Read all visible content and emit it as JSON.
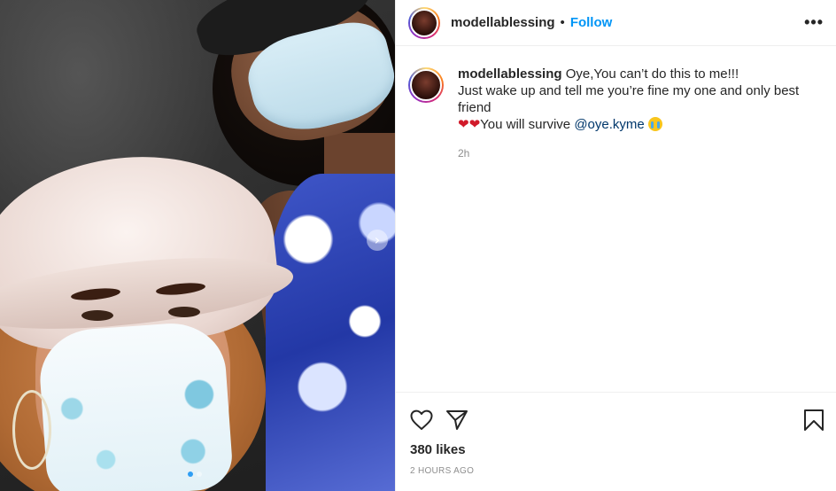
{
  "post": {
    "carousel_count": 2,
    "carousel_index": 1
  },
  "header": {
    "username": "modellablessing",
    "separator": "•",
    "follow_label": "Follow",
    "more_label": "•••"
  },
  "caption": {
    "username": "modellablessing",
    "line1": "Oye,You can’t do this to me!!!",
    "line2": "Just wake up and tell me you’re fine my one and only best friend",
    "hearts": "❤❤",
    "line3": "You will survive ",
    "mention": "@oye.kyme",
    "emoji": "crying-face",
    "time_ago": "2h"
  },
  "actions": {
    "like_icon": "heart-outline-icon",
    "share_icon": "paper-plane-icon",
    "save_icon": "bookmark-icon"
  },
  "likes_text": "380 likes",
  "posted_time": "2 HOURS AGO",
  "colors": {
    "follow": "#0095f6",
    "mention": "#00376b",
    "muted": "#8e8e8e",
    "text": "#262626",
    "carousel_active": "#2f9ef4"
  }
}
